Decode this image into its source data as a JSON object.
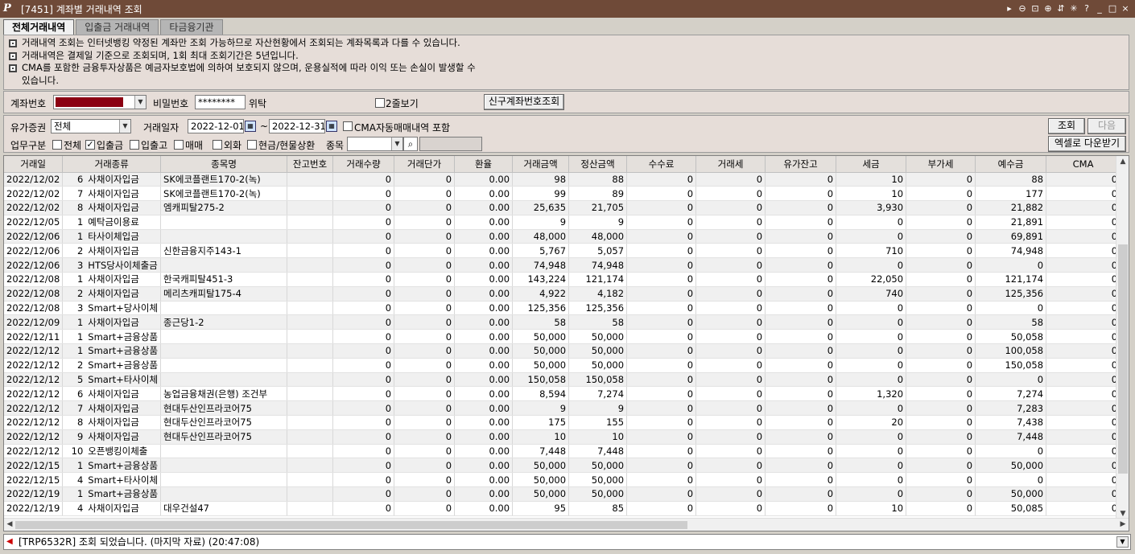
{
  "window": {
    "logo": "P",
    "title": "[7451] 계좌별 거래내역 조회",
    "icons": [
      "pin-icon",
      "zoom-out-icon",
      "fit-icon",
      "zoom-in-icon",
      "link-icon",
      "settings-icon",
      "help-icon",
      "minimize-icon",
      "restore-icon",
      "close-icon"
    ],
    "icon_glyphs": [
      "▸",
      "⊖",
      "⊡",
      "⊕",
      "⇵",
      "✳",
      "?",
      "_",
      "□",
      "×"
    ]
  },
  "tabs": [
    {
      "label": "전체거래내역",
      "active": true
    },
    {
      "label": "입출금 거래내역",
      "active": false
    },
    {
      "label": "타금융기관",
      "active": false
    }
  ],
  "notices": [
    "거래내역 조회는 인터넷뱅킹 약정된 계좌만 조회 가능하므로 자산현황에서 조회되는 계좌목록과 다를 수 있습니다.",
    "거래내역은 결제일 기준으로 조회되며, 1회 최대 조회기간은 5년입니다.",
    "CMA를 포함한 금융투자상품은 예금자보호법에 의하여 보호되지 않으며, 운용실적에 따라 이익 또는 손실이 발생할 수",
    "있습니다."
  ],
  "account": {
    "account_label": "계좌번호",
    "account_color": "#8b0012",
    "password_label": "비밀번호",
    "password_value": "********",
    "password_suffix": "위탁",
    "two_line_label": "2줄보기",
    "new_account_button": "신구계좌번호조회"
  },
  "filters": {
    "security_label": "유가증권",
    "security_value": "전체",
    "date_label": "거래일자",
    "date_from": "2022-12-01",
    "date_sep": "~",
    "date_to": "2022-12-31",
    "cma_label": "CMA자동매매내역 포함",
    "business_label": "업무구분",
    "opt_all": "전체",
    "opt_deposit": "입출금",
    "opt_inout": "입출고",
    "opt_trade": "매매",
    "opt_fx": "외화",
    "opt_cash": "현금/현물상환",
    "item_label": "종목",
    "check_mark": "✓",
    "search_button": "조회",
    "next_button": "다음",
    "excel_button": "엑셀로 다운받기"
  },
  "table": {
    "columns": [
      "거래일",
      "거래종류",
      "종목명",
      "잔고번호",
      "거래수량",
      "거래단가",
      "환율",
      "거래금액",
      "정산금액",
      "수수료",
      "거래세",
      "유가잔고",
      "세금",
      "부가세",
      "예수금",
      "CMA"
    ],
    "rows": [
      [
        "2022/12/02",
        "6",
        "사채이자입금",
        "SK에코플랜트170-2(녹)",
        "",
        "0",
        "0",
        "0.00",
        "98",
        "88",
        "0",
        "0",
        "0",
        "10",
        "0",
        "88",
        "0"
      ],
      [
        "2022/12/02",
        "7",
        "사채이자입금",
        "SK에코플랜트170-2(녹)",
        "",
        "0",
        "0",
        "0.00",
        "99",
        "89",
        "0",
        "0",
        "0",
        "10",
        "0",
        "177",
        "0"
      ],
      [
        "2022/12/02",
        "8",
        "사채이자입금",
        "엠캐피탈275-2",
        "",
        "0",
        "0",
        "0.00",
        "25,635",
        "21,705",
        "0",
        "0",
        "0",
        "3,930",
        "0",
        "21,882",
        "0"
      ],
      [
        "2022/12/05",
        "1",
        "예탁금이용료",
        "",
        "",
        "0",
        "0",
        "0.00",
        "9",
        "9",
        "0",
        "0",
        "0",
        "0",
        "0",
        "21,891",
        "0"
      ],
      [
        "2022/12/06",
        "1",
        "타사이체입금",
        "",
        "",
        "0",
        "0",
        "0.00",
        "48,000",
        "48,000",
        "0",
        "0",
        "0",
        "0",
        "0",
        "69,891",
        "0"
      ],
      [
        "2022/12/06",
        "2",
        "사채이자입금",
        "신한금융지주143-1",
        "",
        "0",
        "0",
        "0.00",
        "5,767",
        "5,057",
        "0",
        "0",
        "0",
        "710",
        "0",
        "74,948",
        "0"
      ],
      [
        "2022/12/06",
        "3",
        "HTS당사이체출금",
        "",
        "",
        "0",
        "0",
        "0.00",
        "74,948",
        "74,948",
        "0",
        "0",
        "0",
        "0",
        "0",
        "0",
        "0"
      ],
      [
        "2022/12/08",
        "1",
        "사채이자입금",
        "한국캐피탈451-3",
        "",
        "0",
        "0",
        "0.00",
        "143,224",
        "121,174",
        "0",
        "0",
        "0",
        "22,050",
        "0",
        "121,174",
        "0"
      ],
      [
        "2022/12/08",
        "2",
        "사채이자입금",
        "메리츠캐피탈175-4",
        "",
        "0",
        "0",
        "0.00",
        "4,922",
        "4,182",
        "0",
        "0",
        "0",
        "740",
        "0",
        "125,356",
        "0"
      ],
      [
        "2022/12/08",
        "3",
        "Smart+당사이체",
        "",
        "",
        "0",
        "0",
        "0.00",
        "125,356",
        "125,356",
        "0",
        "0",
        "0",
        "0",
        "0",
        "0",
        "0"
      ],
      [
        "2022/12/09",
        "1",
        "사채이자입금",
        "종근당1-2",
        "",
        "0",
        "0",
        "0.00",
        "58",
        "58",
        "0",
        "0",
        "0",
        "0",
        "0",
        "58",
        "0"
      ],
      [
        "2022/12/11",
        "1",
        "Smart+금융상품",
        "",
        "",
        "0",
        "0",
        "0.00",
        "50,000",
        "50,000",
        "0",
        "0",
        "0",
        "0",
        "0",
        "50,058",
        "0"
      ],
      [
        "2022/12/12",
        "1",
        "Smart+금융상품",
        "",
        "",
        "0",
        "0",
        "0.00",
        "50,000",
        "50,000",
        "0",
        "0",
        "0",
        "0",
        "0",
        "100,058",
        "0"
      ],
      [
        "2022/12/12",
        "2",
        "Smart+금융상품",
        "",
        "",
        "0",
        "0",
        "0.00",
        "50,000",
        "50,000",
        "0",
        "0",
        "0",
        "0",
        "0",
        "150,058",
        "0"
      ],
      [
        "2022/12/12",
        "5",
        "Smart+타사이체",
        "",
        "",
        "0",
        "0",
        "0.00",
        "150,058",
        "150,058",
        "0",
        "0",
        "0",
        "0",
        "0",
        "0",
        "0"
      ],
      [
        "2022/12/12",
        "6",
        "사채이자입금",
        "농업금융채권(은행) 조건부",
        "",
        "0",
        "0",
        "0.00",
        "8,594",
        "7,274",
        "0",
        "0",
        "0",
        "1,320",
        "0",
        "7,274",
        "0"
      ],
      [
        "2022/12/12",
        "7",
        "사채이자입금",
        "현대두산인프라코어75",
        "",
        "0",
        "0",
        "0.00",
        "9",
        "9",
        "0",
        "0",
        "0",
        "0",
        "0",
        "7,283",
        "0"
      ],
      [
        "2022/12/12",
        "8",
        "사채이자입금",
        "현대두산인프라코어75",
        "",
        "0",
        "0",
        "0.00",
        "175",
        "155",
        "0",
        "0",
        "0",
        "20",
        "0",
        "7,438",
        "0"
      ],
      [
        "2022/12/12",
        "9",
        "사채이자입금",
        "현대두산인프라코어75",
        "",
        "0",
        "0",
        "0.00",
        "10",
        "10",
        "0",
        "0",
        "0",
        "0",
        "0",
        "7,448",
        "0"
      ],
      [
        "2022/12/12",
        "10",
        "오픈뱅킹이체출",
        "",
        "",
        "0",
        "0",
        "0.00",
        "7,448",
        "7,448",
        "0",
        "0",
        "0",
        "0",
        "0",
        "0",
        "0"
      ],
      [
        "2022/12/15",
        "1",
        "Smart+금융상품",
        "",
        "",
        "0",
        "0",
        "0.00",
        "50,000",
        "50,000",
        "0",
        "0",
        "0",
        "0",
        "0",
        "50,000",
        "0"
      ],
      [
        "2022/12/15",
        "4",
        "Smart+타사이체",
        "",
        "",
        "0",
        "0",
        "0.00",
        "50,000",
        "50,000",
        "0",
        "0",
        "0",
        "0",
        "0",
        "0",
        "0"
      ],
      [
        "2022/12/19",
        "1",
        "Smart+금융상품",
        "",
        "",
        "0",
        "0",
        "0.00",
        "50,000",
        "50,000",
        "0",
        "0",
        "0",
        "0",
        "0",
        "50,000",
        "0"
      ],
      [
        "2022/12/19",
        "4",
        "사채이자입금",
        "대우건설47",
        "",
        "0",
        "0",
        "0.00",
        "95",
        "85",
        "0",
        "0",
        "0",
        "10",
        "0",
        "50,085",
        "0"
      ]
    ]
  },
  "status": {
    "icon": "speaker-icon",
    "message": "[TRP6532R] 조회 되었습니다. (마지막 자료) (20:47:08)"
  }
}
